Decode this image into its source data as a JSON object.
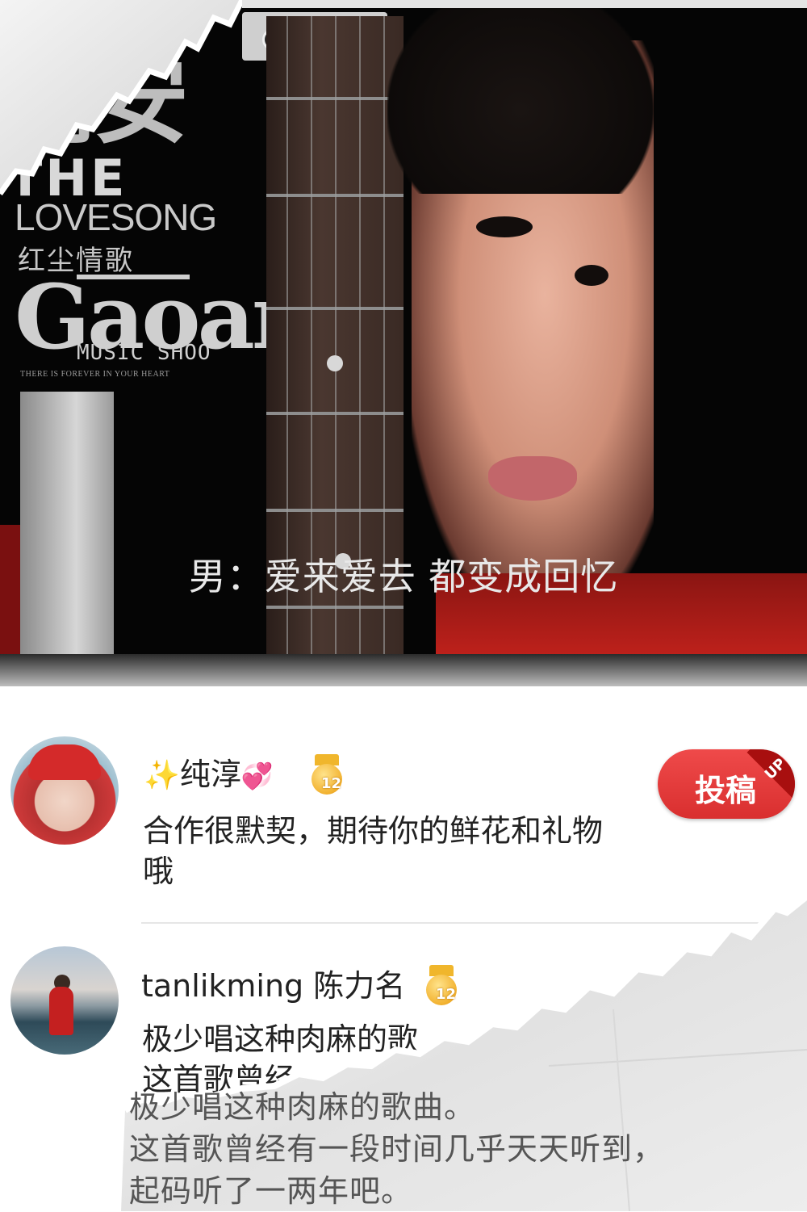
{
  "video": {
    "cover": {
      "title_cn": "高安",
      "the": "THE",
      "lovesong": "LOVESONG",
      "subtitle_cn": "红尘情歌",
      "brand": "Gaoan",
      "brand_sub": "MUSIC SHOO",
      "tagline": "THERE IS FOREVER IN YOUR HEART"
    },
    "lyric": "男：爱来爱去 都变成回忆"
  },
  "comments": [
    {
      "user_prefix": "✨",
      "user": "纯淳",
      "user_suffix": "💞",
      "level": "12",
      "text": "合作很默契，期待你的鲜花和礼物哦"
    },
    {
      "user": "tanlikming 陈力名",
      "level": "12",
      "text_visible": "极少唱这种肉麻的歌",
      "text_line2": "这首歌曾经"
    }
  ],
  "submit_button": {
    "label": "投稿",
    "tag": "UP"
  },
  "quote": {
    "lines": [
      "极少唱这种肉麻的歌曲。",
      "这首歌曾经有一段时间几乎天天听到，",
      "起码听了一两年吧。"
    ]
  },
  "colors": {
    "accent_red": "#e03a3a",
    "medal_gold": "#f2b230",
    "lyric_text": "#e8e8e8"
  }
}
